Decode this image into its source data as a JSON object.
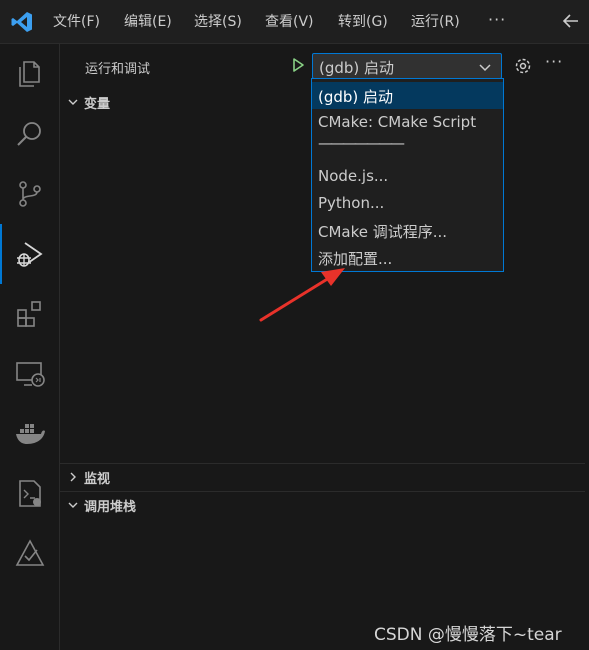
{
  "menubar": {
    "items": [
      "文件(F)",
      "编辑(E)",
      "选择(S)",
      "查看(V)",
      "转到(G)",
      "运行(R)"
    ],
    "more": "···"
  },
  "activity_bar": {
    "icons": [
      "explorer-icon",
      "search-icon",
      "source-control-icon",
      "run-debug-icon",
      "extensions-icon",
      "remote-explorer-icon",
      "docker-icon",
      "cmake-icon",
      "testing-icon"
    ],
    "active": "run-debug-icon",
    "accent": "#0078d4"
  },
  "panel": {
    "title": "运行和调试",
    "selected_config": "(gdb) 启动",
    "more": "···",
    "sections": {
      "variables": "变量",
      "watch": "监视",
      "call_stack": "调用堆栈"
    }
  },
  "dropdown": {
    "options": [
      "(gdb) 启动",
      "CMake: CMake Script",
      "———————",
      "Node.js...",
      "Python...",
      "CMake 调试程序...",
      "添加配置..."
    ],
    "selected_index": 0
  },
  "watermark": "CSDN @慢慢落下~tear",
  "colors": {
    "background": "#181818",
    "focus_border": "#0078d4",
    "selected_option": "#04395e",
    "run_green": "#89d185",
    "annotation_arrow": "#e8322a"
  }
}
